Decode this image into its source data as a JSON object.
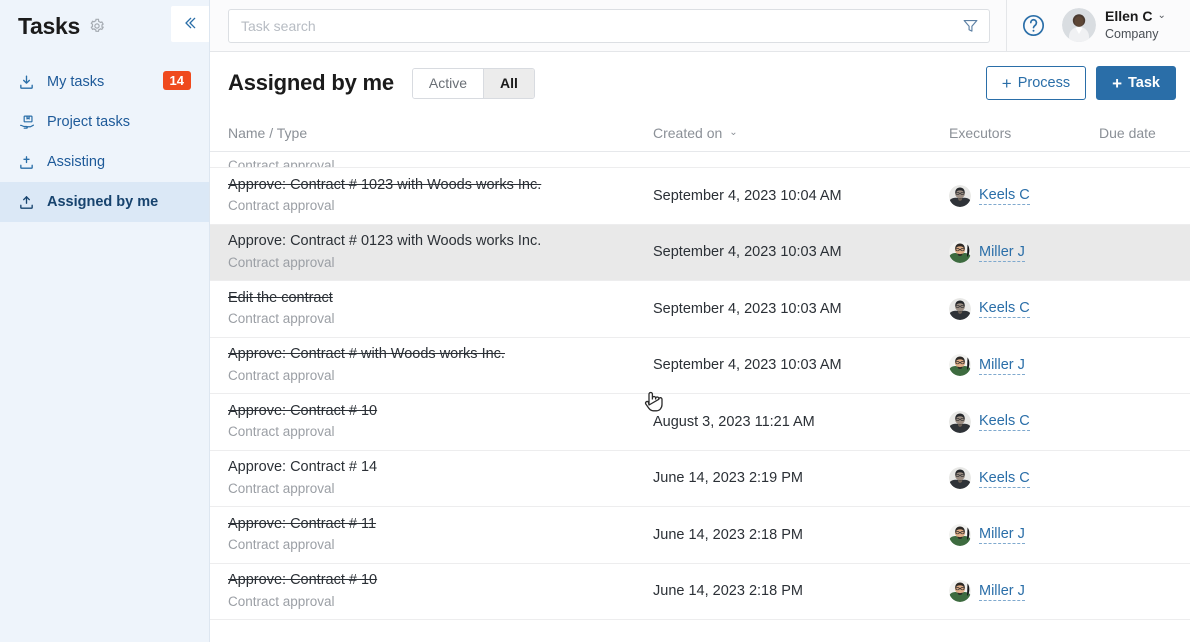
{
  "sidebar": {
    "title": "Tasks",
    "gear_icon": "gear-icon",
    "collapse_icon": "chevron-double-left-icon",
    "items": [
      {
        "label": "My tasks",
        "icon": "download-tray-icon",
        "badge": "14",
        "active": false
      },
      {
        "label": "Project tasks",
        "icon": "hand-holding-box-icon",
        "badge": "",
        "active": false
      },
      {
        "label": "Assisting",
        "icon": "tray-plus-icon",
        "badge": "",
        "active": false
      },
      {
        "label": "Assigned by me",
        "icon": "upload-tray-icon",
        "badge": "",
        "active": true
      }
    ]
  },
  "topbar": {
    "search": {
      "placeholder": "Task search",
      "value": ""
    },
    "filter_icon": "funnel-filter-icon",
    "help_icon": "question-circle-icon",
    "user": {
      "name": "Ellen C",
      "org": "Company",
      "caret": "⌄",
      "avatar": "user-avatar"
    }
  },
  "page": {
    "title": "Assigned by me",
    "tabs": [
      {
        "label": "Active",
        "selected": false
      },
      {
        "label": "All",
        "selected": true
      }
    ],
    "buttons": {
      "process": {
        "label": "Process",
        "plus": "+"
      },
      "task": {
        "label": "Task",
        "plus": "+"
      }
    }
  },
  "table": {
    "columns": [
      {
        "key": "name",
        "label": "Name / Type",
        "sortable": false
      },
      {
        "key": "created",
        "label": "Created on",
        "sortable": true,
        "sort_caret": "⌄"
      },
      {
        "key": "exec",
        "label": "Executors",
        "sortable": false
      },
      {
        "key": "due",
        "label": "Due date",
        "sortable": false
      }
    ],
    "partial_row_top": {
      "type": "Contract approval"
    },
    "rows": [
      {
        "name": "Approve: Contract # 1023 with Woods works Inc.",
        "type": "Contract approval",
        "completed": true,
        "created": "September 4, 2023 10:04 AM",
        "executor": "Keels C",
        "executor_avatar": "keels",
        "due": "",
        "hovered": false
      },
      {
        "name": "Approve: Contract # 0123 with Woods works Inc.",
        "type": "Contract approval",
        "completed": false,
        "created": "September 4, 2023 10:03 AM",
        "executor": "Miller J",
        "executor_avatar": "miller",
        "due": "",
        "hovered": true
      },
      {
        "name": "Edit the contract",
        "type": "Contract approval",
        "completed": true,
        "created": "September 4, 2023 10:03 AM",
        "executor": "Keels C",
        "executor_avatar": "keels",
        "due": "",
        "hovered": false
      },
      {
        "name": "Approve: Contract # with Woods works Inc.",
        "type": "Contract approval",
        "completed": true,
        "created": "September 4, 2023 10:03 AM",
        "executor": "Miller J",
        "executor_avatar": "miller",
        "due": "",
        "hovered": false
      },
      {
        "name": "Approve: Contract # 10",
        "type": "Contract approval",
        "completed": true,
        "created": "August 3, 2023 11:21 AM",
        "executor": "Keels C",
        "executor_avatar": "keels",
        "due": "",
        "hovered": false
      },
      {
        "name": "Approve: Contract # 14",
        "type": "Contract approval",
        "completed": false,
        "created": "June 14, 2023 2:19 PM",
        "executor": "Keels C",
        "executor_avatar": "keels",
        "due": "",
        "hovered": false
      },
      {
        "name": "Approve: Contract # 11",
        "type": "Contract approval",
        "completed": true,
        "created": "June 14, 2023 2:18 PM",
        "executor": "Miller J",
        "executor_avatar": "miller",
        "due": "",
        "hovered": false
      },
      {
        "name": "Approve: Contract # 10",
        "type": "Contract approval",
        "completed": true,
        "created": "June 14, 2023 2:18 PM",
        "executor": "Miller J",
        "executor_avatar": "miller",
        "due": "",
        "hovered": false
      }
    ]
  },
  "colors": {
    "accent": "#2a6ea8",
    "sidebar_bg": "#eef4fb",
    "sidebar_active_bg": "#dbe8f6",
    "badge_bg": "#ef4a1e",
    "row_hover_bg": "#e9e9e9"
  }
}
